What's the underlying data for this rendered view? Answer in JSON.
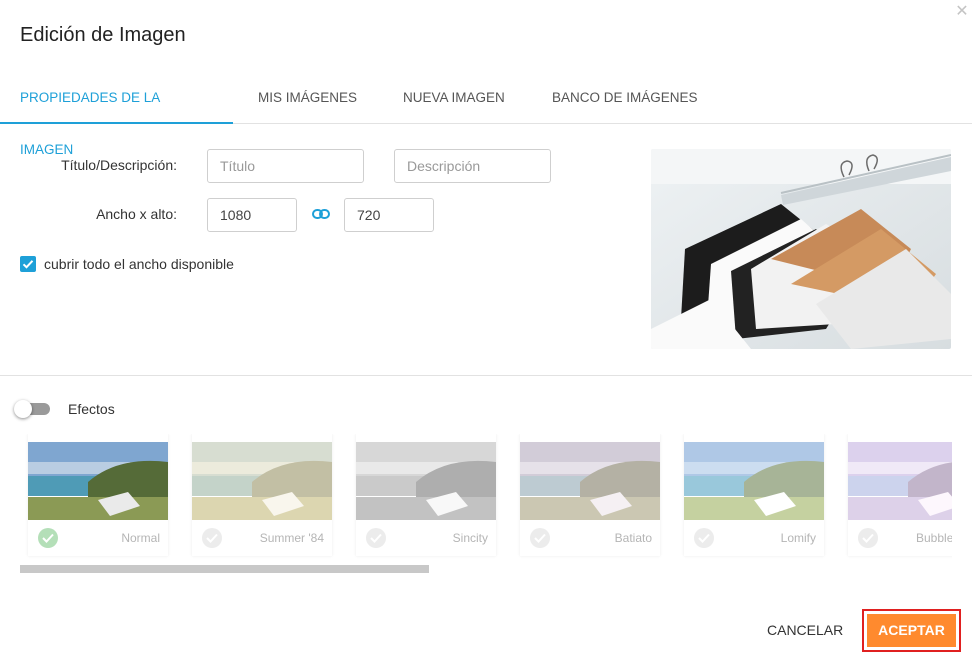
{
  "dialog": {
    "title": "Edición de Imagen",
    "close_icon": "close-icon"
  },
  "tabs": [
    {
      "label": "PROPIEDADES DE LA IMAGEN",
      "active": true
    },
    {
      "label": "MIS IMÁGENES",
      "active": false
    },
    {
      "label": "NUEVA IMAGEN",
      "active": false
    },
    {
      "label": "BANCO DE IMÁGENES",
      "active": false
    }
  ],
  "form": {
    "title_label": "Título/Descripción:",
    "title_placeholder": "Título",
    "description_placeholder": "Descripción",
    "size_label": "Ancho x alto:",
    "width_value": "1080",
    "height_value": "720",
    "link_icon": "chain-link-icon",
    "full_width_label": "cubrir todo el ancho disponible",
    "full_width_checked": true
  },
  "preview": {
    "icon": "clothes-rack-photo"
  },
  "effects": {
    "label": "Efectos",
    "enabled": false,
    "items": [
      {
        "name": "Normal",
        "selected": true
      },
      {
        "name": "Summer '84",
        "selected": false
      },
      {
        "name": "Sincity",
        "selected": false
      },
      {
        "name": "Batiato",
        "selected": false
      },
      {
        "name": "Lomify",
        "selected": false
      },
      {
        "name": "Bubble",
        "selected": false
      }
    ]
  },
  "actions": {
    "cancel_label": "CANCELAR",
    "accept_label": "ACEPTAR"
  },
  "colors": {
    "accent": "#1ea0d8",
    "accept": "#ff8a2e",
    "highlight_outline": "#e02020"
  }
}
